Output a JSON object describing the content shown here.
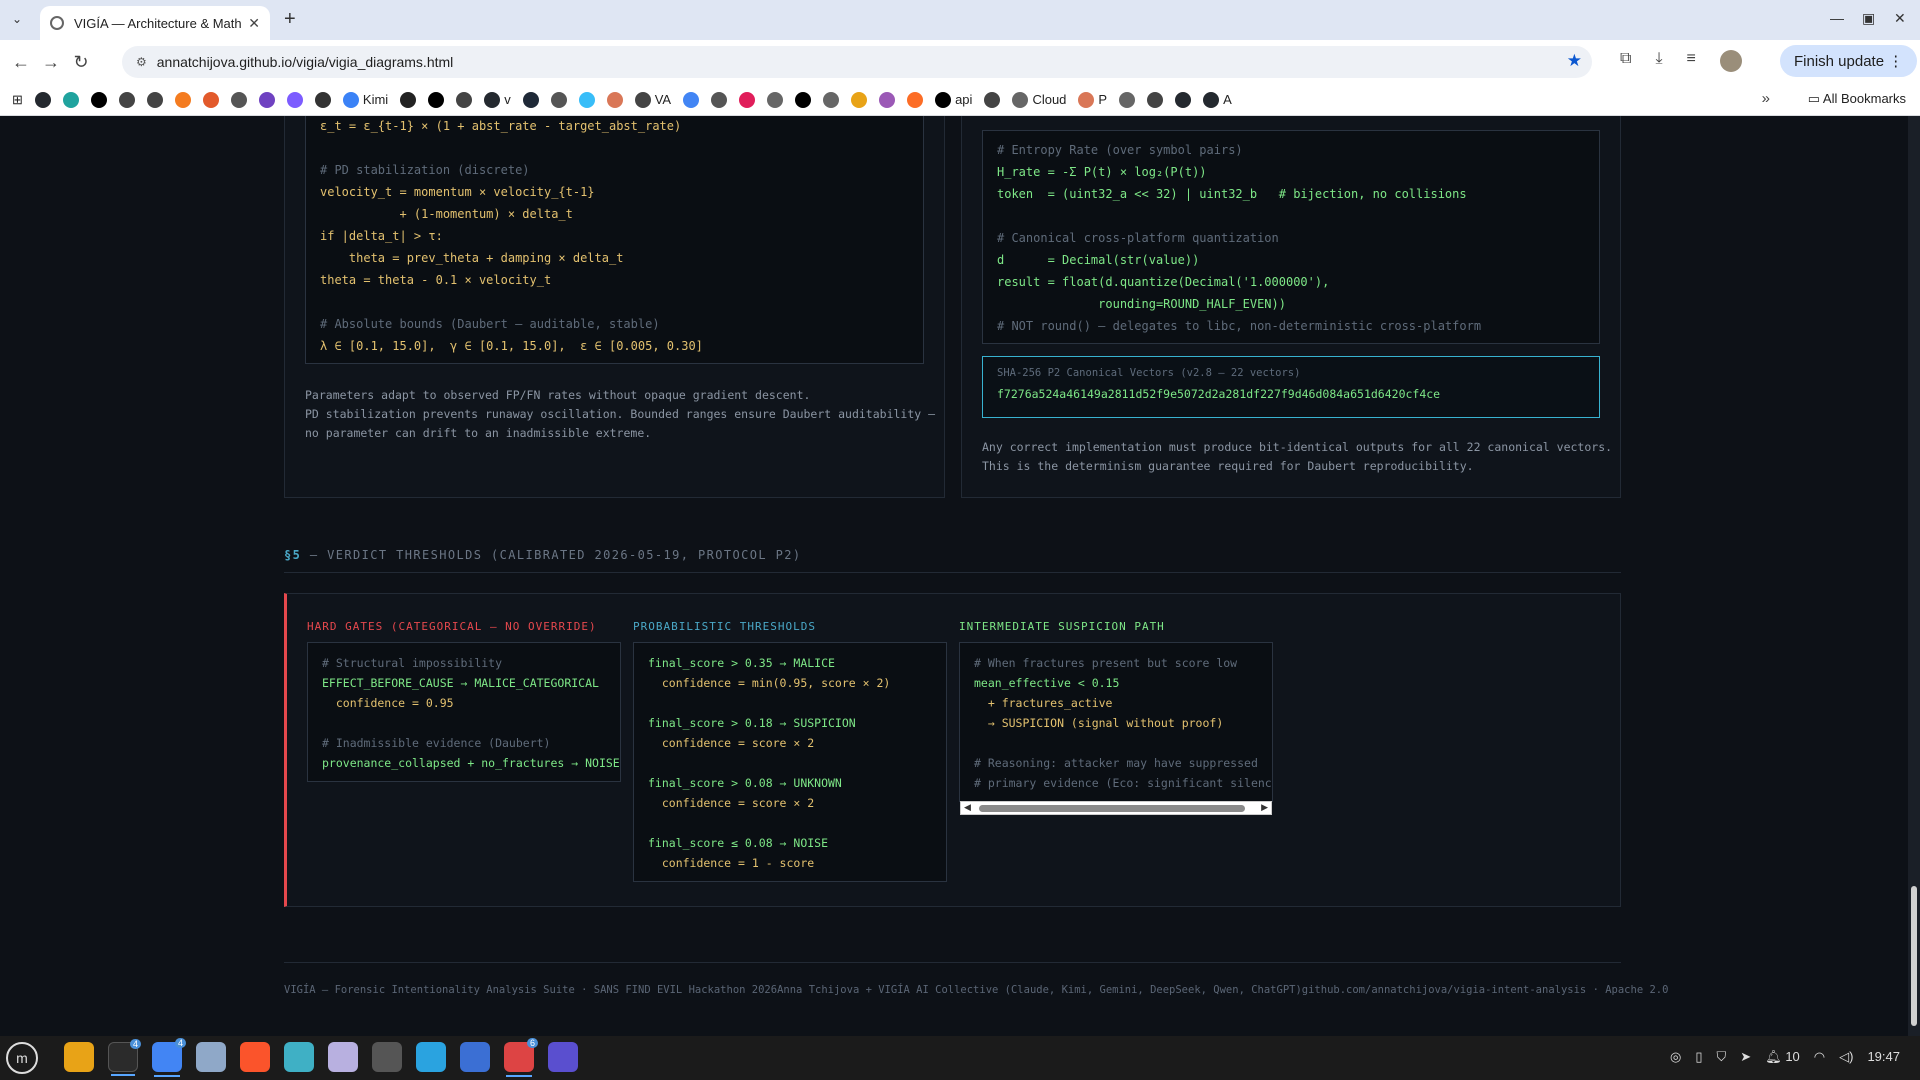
{
  "browser": {
    "tab_title": "VIGÍA — Architecture & Math",
    "url": "annatchijova.github.io/vigia/vigia_diagrams.html",
    "finish_update": "Finish update",
    "all_bookmarks": "All Bookmarks",
    "bookmarks": [
      "Kimi",
      "v",
      "VA",
      "api",
      "Cloud",
      "P",
      "A"
    ]
  },
  "left_panel": {
    "code": [
      {
        "text": "ε_t = ε_{t-1} × (1 + abst_rate - target_abst_rate)",
        "style": "yellow"
      },
      {
        "text": "",
        "style": "yellow"
      },
      {
        "text": "# PD stabilization (discrete)",
        "style": "comment"
      },
      {
        "text": "velocity_t = momentum × velocity_{t-1}",
        "style": "yellow"
      },
      {
        "text": "           + (1-momentum) × delta_t",
        "style": "yellow"
      },
      {
        "text": "if |delta_t| > τ:",
        "style": "yellow"
      },
      {
        "text": "    theta = prev_theta + damping × delta_t",
        "style": "yellow"
      },
      {
        "text": "theta = theta - 0.1 × velocity_t",
        "style": "yellow"
      },
      {
        "text": "",
        "style": "yellow"
      },
      {
        "text": "# Absolute bounds (Daubert — auditable, stable)",
        "style": "comment"
      },
      {
        "text": "λ ∈ [0.1, 15.0],  γ ∈ [0.1, 15.0],  ε ∈ [0.005, 0.30]",
        "style": "yellow"
      }
    ],
    "note": "Parameters adapt to observed FP/FN rates without opaque gradient descent.\nPD stabilization prevents runaway oscillation. Bounded ranges ensure Daubert auditability —\nno parameter can drift to an inadmissible extreme."
  },
  "right_panel": {
    "code": [
      {
        "text": "# Entropy Rate (over symbol pairs)",
        "style": "comment"
      },
      {
        "text": "H_rate = -Σ P(t) × log₂(P(t))",
        "style": "green"
      },
      {
        "text": "token  = (uint32_a << 32) | uint32_b   # bijection, no collisions",
        "style": "mixed"
      },
      {
        "text": "",
        "style": "green"
      },
      {
        "text": "# Canonical cross-platform quantization",
        "style": "comment"
      },
      {
        "text": "d      = Decimal(str(value))",
        "style": "green"
      },
      {
        "text": "result = float(d.quantize(Decimal('1.000000'),",
        "style": "green"
      },
      {
        "text": "              rounding=ROUND_HALF_EVEN))",
        "style": "green"
      },
      {
        "text": "# NOT round() — delegates to libc, non-deterministic cross-platform",
        "style": "comment"
      }
    ],
    "sha_label": "SHA-256 P2 Canonical Vectors (v2.8 — 22 vectors)",
    "sha_value": "f7276a524a46149a2811d52f9e5072d2a281df227f9d46d084a651d6420cf4ce",
    "note": "Any correct implementation must produce bit-identical outputs for all 22 canonical vectors.\nThis is the determinism guarantee required for Daubert reproducibility."
  },
  "section5": {
    "num": "§5",
    "title": " — VERDICT THRESHOLDS (CALIBRATED 2026-05-19, PROTOCOL P2)",
    "hard_gates": {
      "heading": "HARD GATES (CATEGORICAL — NO OVERRIDE)",
      "color": "#e5484d",
      "lines": [
        {
          "text": "# Structural impossibility",
          "style": "comment"
        },
        {
          "text": "EFFECT_BEFORE_CAUSE → MALICE_CATEGORICAL",
          "style": "green"
        },
        {
          "text": "  confidence = 0.95",
          "style": "yellow"
        },
        {
          "text": "",
          "style": "green"
        },
        {
          "text": "# Inadmissible evidence (Daubert)",
          "style": "comment"
        },
        {
          "text": "provenance_collapsed + no_fractures → NOISE",
          "style": "green"
        }
      ]
    },
    "probabilistic": {
      "heading": "PROBABILISTIC THRESHOLDS",
      "color": "#4aa8c7",
      "lines": [
        {
          "text": "final_score > 0.35 → MALICE",
          "style": "green"
        },
        {
          "text": "  confidence = min(0.95, score × 2)",
          "style": "yellow"
        },
        {
          "text": "",
          "style": "green"
        },
        {
          "text": "final_score > 0.18 → SUSPICION",
          "style": "green"
        },
        {
          "text": "  confidence = score × 2",
          "style": "yellow"
        },
        {
          "text": "",
          "style": "green"
        },
        {
          "text": "final_score > 0.08 → UNKNOWN",
          "style": "green"
        },
        {
          "text": "  confidence = score × 2",
          "style": "yellow"
        },
        {
          "text": "",
          "style": "green"
        },
        {
          "text": "final_score ≤ 0.08 → NOISE",
          "style": "green"
        },
        {
          "text": "  confidence = 1 - score",
          "style": "yellow"
        }
      ]
    },
    "intermediate": {
      "heading": "INTERMEDIATE SUSPICION PATH",
      "color": "#7ee787",
      "lines": [
        {
          "text": "# When fractures present but score low",
          "style": "comment"
        },
        {
          "text": "mean_effective < 0.15",
          "style": "green"
        },
        {
          "text": "  + fractures_active",
          "style": "yellow"
        },
        {
          "text": "  → SUSPICION (signal without proof)",
          "style": "yellow"
        },
        {
          "text": "",
          "style": "green"
        },
        {
          "text": "# Reasoning: attacker may have suppressed",
          "style": "comment"
        },
        {
          "text": "# primary evidence (Eco: significant silence)",
          "style": "comment"
        }
      ]
    }
  },
  "footer": {
    "left": "VIGÍA — Forensic Intentionality Analysis Suite · SANS FIND EVIL Hackathon 2026",
    "middle": "Anna Tchijova + VIGÍA AI Collective (Claude, Kimi, Gemini, DeepSeek, Qwen, ChatGPT)",
    "right": "github.com/annatchijova/vigia-intent-analysis · Apache 2.0"
  },
  "taskbar": {
    "time": "19:47",
    "notif_count": "10",
    "badge_terminal": "4",
    "badge_chrome": "4",
    "badge_photos": "6"
  }
}
